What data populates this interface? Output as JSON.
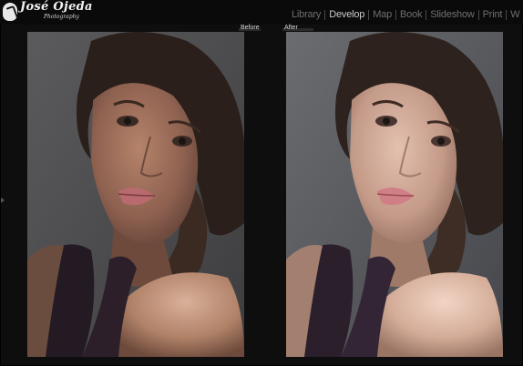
{
  "branding": {
    "logo_name": "José Ojeda",
    "logo_subtitle": "Photography"
  },
  "modules": [
    {
      "label": "Library",
      "active": false
    },
    {
      "label": "Develop",
      "active": true
    },
    {
      "label": "Map",
      "active": false
    },
    {
      "label": "Book",
      "active": false
    },
    {
      "label": "Slideshow",
      "active": false
    },
    {
      "label": "Print",
      "active": false
    },
    {
      "label": "W",
      "active": false
    }
  ],
  "compare": {
    "before_label": "Before",
    "after_label": "After"
  },
  "colors": {
    "background": "#0e0e0e",
    "active_module": "#c9c9c9",
    "inactive_module": "#6f6f6f"
  }
}
